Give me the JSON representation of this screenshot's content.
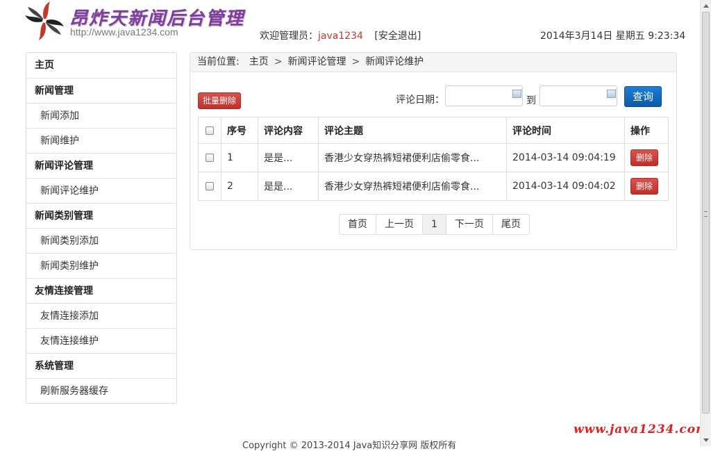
{
  "header": {
    "site_title": "昂炸天新闻后台管理",
    "site_url": "http://www.java1234.com",
    "welcome_label": "欢迎管理员：",
    "admin_name": "java1234",
    "logout_label": "[安全退出]",
    "datetime": "2014年3月14日 星期五 9:23:34"
  },
  "sidebar": {
    "items": [
      {
        "label": "主页",
        "kind": "group"
      },
      {
        "label": "新闻管理",
        "kind": "group"
      },
      {
        "label": "新闻添加",
        "kind": "sub"
      },
      {
        "label": "新闻维护",
        "kind": "sub"
      },
      {
        "label": "新闻评论管理",
        "kind": "group"
      },
      {
        "label": "新闻评论维护",
        "kind": "sub"
      },
      {
        "label": "新闻类别管理",
        "kind": "group"
      },
      {
        "label": "新闻类别添加",
        "kind": "sub"
      },
      {
        "label": "新闻类别维护",
        "kind": "sub"
      },
      {
        "label": "友情连接管理",
        "kind": "group"
      },
      {
        "label": "友情连接添加",
        "kind": "sub"
      },
      {
        "label": "友情连接维护",
        "kind": "sub"
      },
      {
        "label": "系统管理",
        "kind": "group"
      },
      {
        "label": "刷新服务器缓存",
        "kind": "sub"
      }
    ]
  },
  "breadcrumb": {
    "lead": "当前位置:",
    "items": [
      "主页",
      "新闻评论管理",
      "新闻评论维护"
    ],
    "separator": ">"
  },
  "toolbar": {
    "batch_delete_label": "批量删除",
    "date_label": "评论日期：",
    "date_from_value": "",
    "to_label": "到",
    "date_to_value": "",
    "query_label": "查询"
  },
  "table": {
    "columns": [
      "序号",
      "评论内容",
      "评论主题",
      "评论时间",
      "操作"
    ],
    "rows": [
      {
        "index": "1",
        "content": "是是...",
        "topic": "香港少女穿热裤短裙便利店偷零食...",
        "time": "2014-03-14 09:04:19",
        "action": "删除"
      },
      {
        "index": "2",
        "content": "是是...",
        "topic": "香港少女穿热裤短裙便利店偷零食...",
        "time": "2014-03-14 09:04:02",
        "action": "删除"
      }
    ]
  },
  "pager": {
    "first": "首页",
    "prev": "上一页",
    "current": "1",
    "next": "下一页",
    "last": "尾页"
  },
  "footer": {
    "text": "Copyright © 2013-2014 Java知识分享网 版权所有"
  },
  "watermark": "www.java1234.com",
  "colors": {
    "brand_purple": "#7b3f98",
    "danger_red": "#c9302c",
    "primary_blue": "#0d5aa7",
    "admin_name_red": "#c0392b"
  }
}
